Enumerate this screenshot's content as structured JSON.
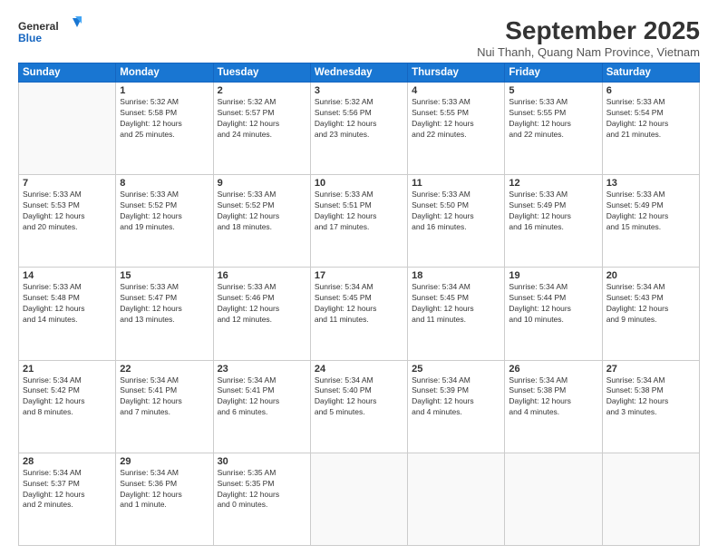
{
  "logo": {
    "general": "General",
    "blue": "Blue"
  },
  "title": "September 2025",
  "location": "Nui Thanh, Quang Nam Province, Vietnam",
  "days_of_week": [
    "Sunday",
    "Monday",
    "Tuesday",
    "Wednesday",
    "Thursday",
    "Friday",
    "Saturday"
  ],
  "weeks": [
    [
      {
        "day": "",
        "info": ""
      },
      {
        "day": "1",
        "info": "Sunrise: 5:32 AM\nSunset: 5:58 PM\nDaylight: 12 hours\nand 25 minutes."
      },
      {
        "day": "2",
        "info": "Sunrise: 5:32 AM\nSunset: 5:57 PM\nDaylight: 12 hours\nand 24 minutes."
      },
      {
        "day": "3",
        "info": "Sunrise: 5:32 AM\nSunset: 5:56 PM\nDaylight: 12 hours\nand 23 minutes."
      },
      {
        "day": "4",
        "info": "Sunrise: 5:33 AM\nSunset: 5:55 PM\nDaylight: 12 hours\nand 22 minutes."
      },
      {
        "day": "5",
        "info": "Sunrise: 5:33 AM\nSunset: 5:55 PM\nDaylight: 12 hours\nand 22 minutes."
      },
      {
        "day": "6",
        "info": "Sunrise: 5:33 AM\nSunset: 5:54 PM\nDaylight: 12 hours\nand 21 minutes."
      }
    ],
    [
      {
        "day": "7",
        "info": "Sunrise: 5:33 AM\nSunset: 5:53 PM\nDaylight: 12 hours\nand 20 minutes."
      },
      {
        "day": "8",
        "info": "Sunrise: 5:33 AM\nSunset: 5:52 PM\nDaylight: 12 hours\nand 19 minutes."
      },
      {
        "day": "9",
        "info": "Sunrise: 5:33 AM\nSunset: 5:52 PM\nDaylight: 12 hours\nand 18 minutes."
      },
      {
        "day": "10",
        "info": "Sunrise: 5:33 AM\nSunset: 5:51 PM\nDaylight: 12 hours\nand 17 minutes."
      },
      {
        "day": "11",
        "info": "Sunrise: 5:33 AM\nSunset: 5:50 PM\nDaylight: 12 hours\nand 16 minutes."
      },
      {
        "day": "12",
        "info": "Sunrise: 5:33 AM\nSunset: 5:49 PM\nDaylight: 12 hours\nand 16 minutes."
      },
      {
        "day": "13",
        "info": "Sunrise: 5:33 AM\nSunset: 5:49 PM\nDaylight: 12 hours\nand 15 minutes."
      }
    ],
    [
      {
        "day": "14",
        "info": "Sunrise: 5:33 AM\nSunset: 5:48 PM\nDaylight: 12 hours\nand 14 minutes."
      },
      {
        "day": "15",
        "info": "Sunrise: 5:33 AM\nSunset: 5:47 PM\nDaylight: 12 hours\nand 13 minutes."
      },
      {
        "day": "16",
        "info": "Sunrise: 5:33 AM\nSunset: 5:46 PM\nDaylight: 12 hours\nand 12 minutes."
      },
      {
        "day": "17",
        "info": "Sunrise: 5:34 AM\nSunset: 5:45 PM\nDaylight: 12 hours\nand 11 minutes."
      },
      {
        "day": "18",
        "info": "Sunrise: 5:34 AM\nSunset: 5:45 PM\nDaylight: 12 hours\nand 11 minutes."
      },
      {
        "day": "19",
        "info": "Sunrise: 5:34 AM\nSunset: 5:44 PM\nDaylight: 12 hours\nand 10 minutes."
      },
      {
        "day": "20",
        "info": "Sunrise: 5:34 AM\nSunset: 5:43 PM\nDaylight: 12 hours\nand 9 minutes."
      }
    ],
    [
      {
        "day": "21",
        "info": "Sunrise: 5:34 AM\nSunset: 5:42 PM\nDaylight: 12 hours\nand 8 minutes."
      },
      {
        "day": "22",
        "info": "Sunrise: 5:34 AM\nSunset: 5:41 PM\nDaylight: 12 hours\nand 7 minutes."
      },
      {
        "day": "23",
        "info": "Sunrise: 5:34 AM\nSunset: 5:41 PM\nDaylight: 12 hours\nand 6 minutes."
      },
      {
        "day": "24",
        "info": "Sunrise: 5:34 AM\nSunset: 5:40 PM\nDaylight: 12 hours\nand 5 minutes."
      },
      {
        "day": "25",
        "info": "Sunrise: 5:34 AM\nSunset: 5:39 PM\nDaylight: 12 hours\nand 4 minutes."
      },
      {
        "day": "26",
        "info": "Sunrise: 5:34 AM\nSunset: 5:38 PM\nDaylight: 12 hours\nand 4 minutes."
      },
      {
        "day": "27",
        "info": "Sunrise: 5:34 AM\nSunset: 5:38 PM\nDaylight: 12 hours\nand 3 minutes."
      }
    ],
    [
      {
        "day": "28",
        "info": "Sunrise: 5:34 AM\nSunset: 5:37 PM\nDaylight: 12 hours\nand 2 minutes."
      },
      {
        "day": "29",
        "info": "Sunrise: 5:34 AM\nSunset: 5:36 PM\nDaylight: 12 hours\nand 1 minute."
      },
      {
        "day": "30",
        "info": "Sunrise: 5:35 AM\nSunset: 5:35 PM\nDaylight: 12 hours\nand 0 minutes."
      },
      {
        "day": "",
        "info": ""
      },
      {
        "day": "",
        "info": ""
      },
      {
        "day": "",
        "info": ""
      },
      {
        "day": "",
        "info": ""
      }
    ]
  ]
}
